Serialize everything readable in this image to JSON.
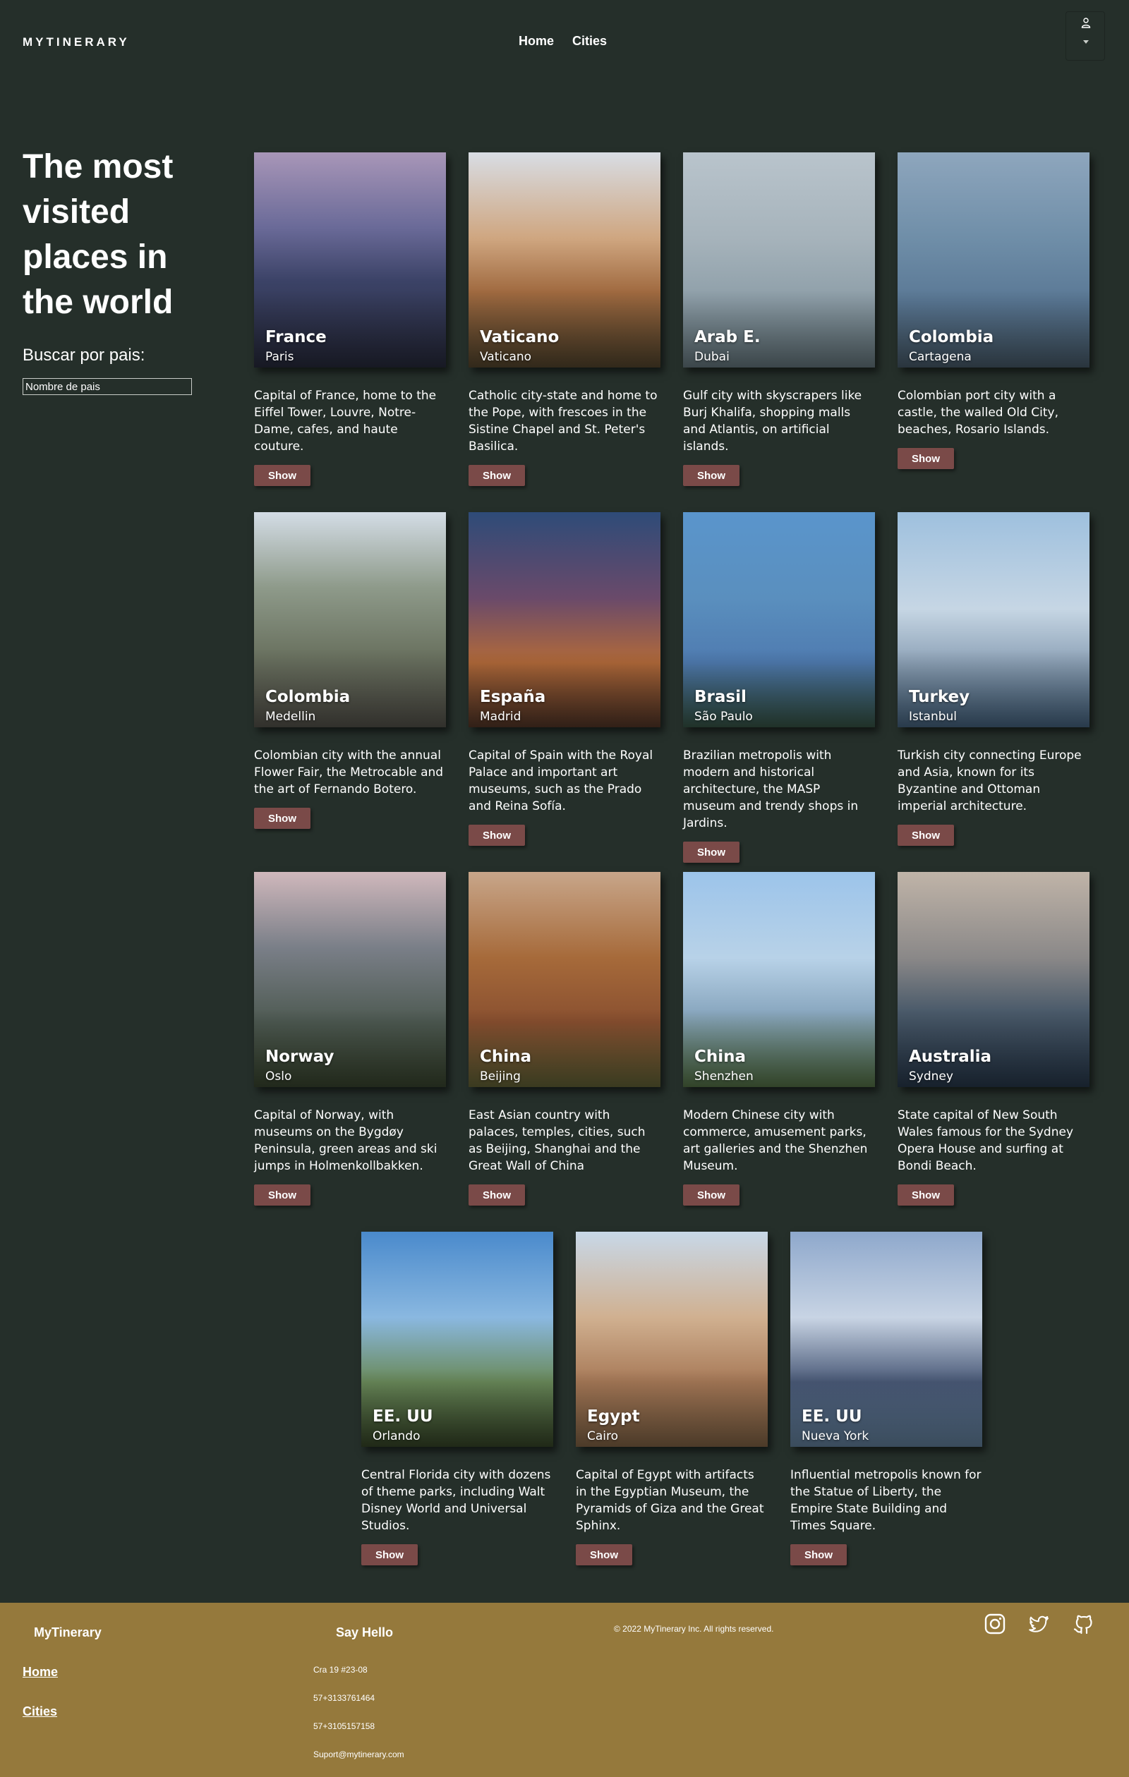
{
  "header": {
    "brand": "MYTINERARY",
    "nav": [
      "Home",
      "Cities"
    ]
  },
  "hero": {
    "title": "The most visited places in the world",
    "search_label": "Buscar por pais:",
    "search_placeholder": "Nombre de pais"
  },
  "cards": [
    {
      "country": "France",
      "city": "Paris",
      "description": "Capital of France, home to the Eiffel Tower, Louvre, Notre-Dame, cafes, and haute couture.",
      "button": "Show",
      "photo": "paris-city-night-photo"
    },
    {
      "country": "Vaticano",
      "city": "Vaticano",
      "description": "Catholic city-state and home to the Pope, with frescoes in the Sistine Chapel and St. Peter's Basilica.",
      "button": "Show",
      "photo": "st-peters-basilica-photo"
    },
    {
      "country": "Arab E.",
      "city": "Dubai",
      "description": "Gulf city with skyscrapers like Burj Khalifa, shopping malls and Atlantis, on artificial islands.",
      "button": "Show",
      "photo": "dubai-coastline-photo"
    },
    {
      "country": "Colombia",
      "city": "Cartagena",
      "description": "Colombian port city with a castle, the walled Old City, beaches, Rosario Islands.",
      "button": "Show",
      "photo": "cartagena-cross-bay-photo"
    },
    {
      "country": "Colombia",
      "city": "Medellin",
      "description": "Colombian city with the annual Flower Fair, the Metrocable and the art of Fernando Botero.",
      "button": "Show",
      "photo": "medellin-valley-photo"
    },
    {
      "country": "España",
      "city": "Madrid",
      "description": "Capital of Spain with the Royal Palace and important art museums, such as the Prado and Reina Sofía.",
      "button": "Show",
      "photo": "madrid-gran-via-photo"
    },
    {
      "country": "Brasil",
      "city": "São Paulo",
      "description": "Brazilian metropolis with modern and historical architecture, the MASP museum and trendy shops in Jardins.",
      "button": "Show",
      "photo": "christ-redeemer-photo"
    },
    {
      "country": "Turkey",
      "city": "Istanbul",
      "description": "Turkish city connecting Europe and Asia, known for its Byzantine and Ottoman imperial architecture.",
      "button": "Show",
      "photo": "istanbul-mosque-photo"
    },
    {
      "country": "Norway",
      "city": "Oslo",
      "description": "Capital of Norway, with museums on the Bygdøy Peninsula, green areas and ski jumps in Holmenkollbakken.",
      "button": "Show",
      "photo": "oslo-city-photo"
    },
    {
      "country": "China",
      "city": "Beijing",
      "description": "East Asian country with palaces, temples, cities, such as Beijing, Shanghai and the Great Wall of China",
      "button": "Show",
      "photo": "beijing-pagoda-photo"
    },
    {
      "country": "China",
      "city": "Shenzhen",
      "description": "Modern Chinese city with commerce, amusement parks, art galleries and the Shenzhen Museum.",
      "button": "Show",
      "photo": "shenzhen-skyline-photo"
    },
    {
      "country": "Australia",
      "city": "Sydney",
      "description": "State capital of New South Wales famous for the Sydney Opera House and surfing at Bondi Beach.",
      "button": "Show",
      "photo": "sydney-opera-house-photo"
    },
    {
      "country": "EE. UU",
      "city": "Orlando",
      "description": "Central Florida city with dozens of theme parks, including Walt Disney World and Universal Studios.",
      "button": "Show",
      "photo": "orlando-castle-photo"
    },
    {
      "country": "Egypt",
      "city": "Cairo",
      "description": "Capital of Egypt with artifacts in the Egyptian Museum, the Pyramids of Giza and the Great Sphinx.",
      "button": "Show",
      "photo": "cairo-mosques-photo"
    },
    {
      "country": "EE. UU",
      "city": "Nueva York",
      "description": "Influential metropolis known for the Statue of Liberty, the Empire State Building and Times Square.",
      "button": "Show",
      "photo": "new-york-skyline-photo"
    }
  ],
  "footer": {
    "brand": "MyTinerary",
    "links": [
      "Home",
      "Cities"
    ],
    "hello_title": "Say Hello",
    "contacts": [
      "Cra 19 #23-08",
      "57+3133761464",
      "57+3105157158",
      "Suport@mytinerary.com"
    ],
    "copyright": "© 2022 MyTinerary Inc. All rights reserved.",
    "social": [
      "instagram-icon",
      "twitter-icon",
      "github-icon"
    ]
  },
  "colors": {
    "background": "#252f2a",
    "footer": "#95793c",
    "button": "#7a4a48"
  }
}
